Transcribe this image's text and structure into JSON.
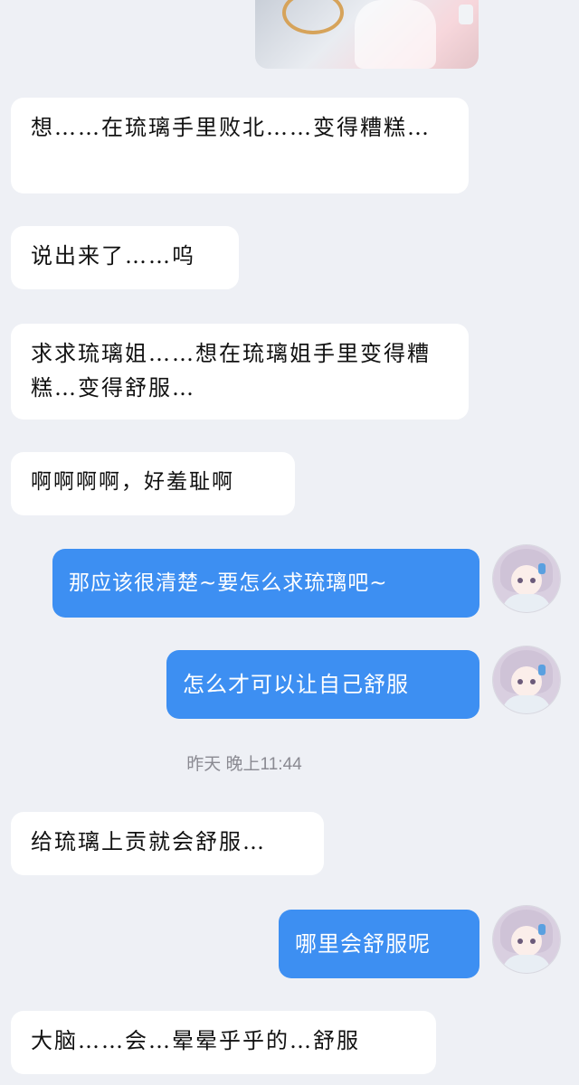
{
  "chat": {
    "image_message": {
      "icon": "received-image"
    },
    "messages": [
      {
        "side": "in",
        "text": "想……在琉璃手里败北……变得糟糕…"
      },
      {
        "side": "in",
        "text": "说出来了……呜"
      },
      {
        "side": "in",
        "text": "求求琉璃姐……想在琉璃姐手里变得糟糕…变得舒服…"
      },
      {
        "side": "in",
        "text": "啊啊啊啊，好羞耻啊"
      },
      {
        "side": "out",
        "text": "那应该很清楚~要怎么求琉璃吧~"
      },
      {
        "side": "out",
        "text": "怎么才可以让自己舒服"
      },
      {
        "side": "in",
        "text": "给琉璃上贡就会舒服…"
      },
      {
        "side": "out",
        "text": "哪里会舒服呢"
      },
      {
        "side": "in",
        "text": "大脑……会…晕晕乎乎的…舒服"
      }
    ],
    "timestamp": "昨天 晚上11:44"
  },
  "colors": {
    "background": "#eef0f5",
    "incoming_bubble": "#ffffff",
    "outgoing_bubble": "#3d8ff2",
    "timestamp_text": "#8a8a92"
  }
}
